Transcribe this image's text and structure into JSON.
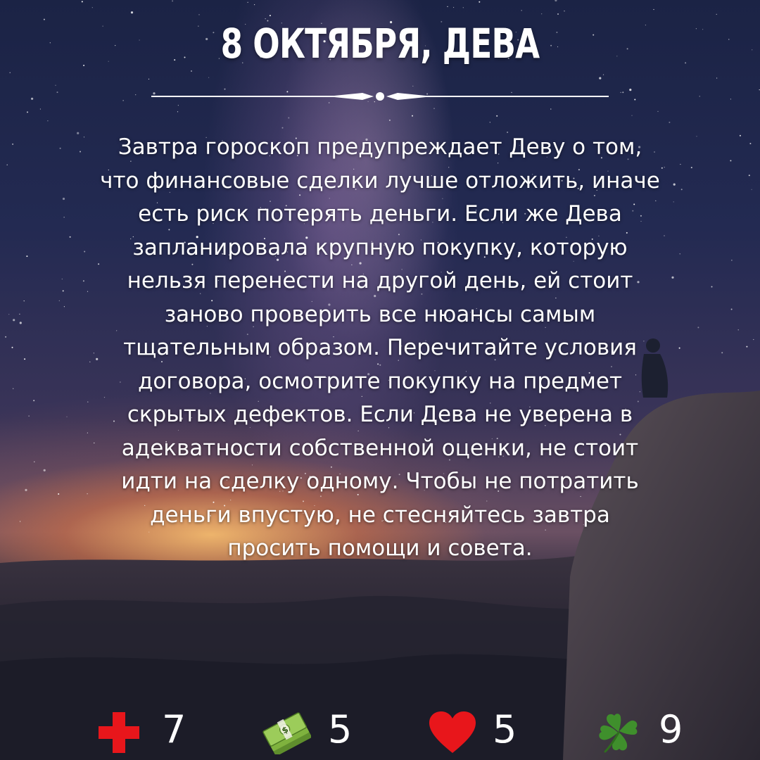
{
  "title": "8 ОКТЯБРЯ, ДЕВА",
  "body_text": "Завтра гороскоп предупреждает Деву о том,\nчто финансовые сделки лучше отложить, иначе\nесть риск потерять деньги. Если же Дева\nзапланировала крупную покупку, которую\nнельзя перенести на другой день, ей стоит\nзаново проверить все нюансы самым\nтщательным образом. Перечитайте условия\nдоговора, осмотрите покупку на предмет\nскрытых дефектов. Если Дева не уверена в\nадекватности собственной оценки, не стоит\nидти на сделку одному. Чтобы не потратить\nденьги впустую, не стесняйтесь завтра\nпросить помощи и совета.",
  "ratings": [
    {
      "icon": "red-cross-icon",
      "value": "7",
      "color": "#e8161b"
    },
    {
      "icon": "money-stack-icon",
      "value": "5",
      "color": "#7fb23e"
    },
    {
      "icon": "heart-icon",
      "value": "5",
      "color": "#e8161b"
    },
    {
      "icon": "four-leaf-clover-icon",
      "value": "9",
      "color": "#3f8f2c"
    }
  ]
}
